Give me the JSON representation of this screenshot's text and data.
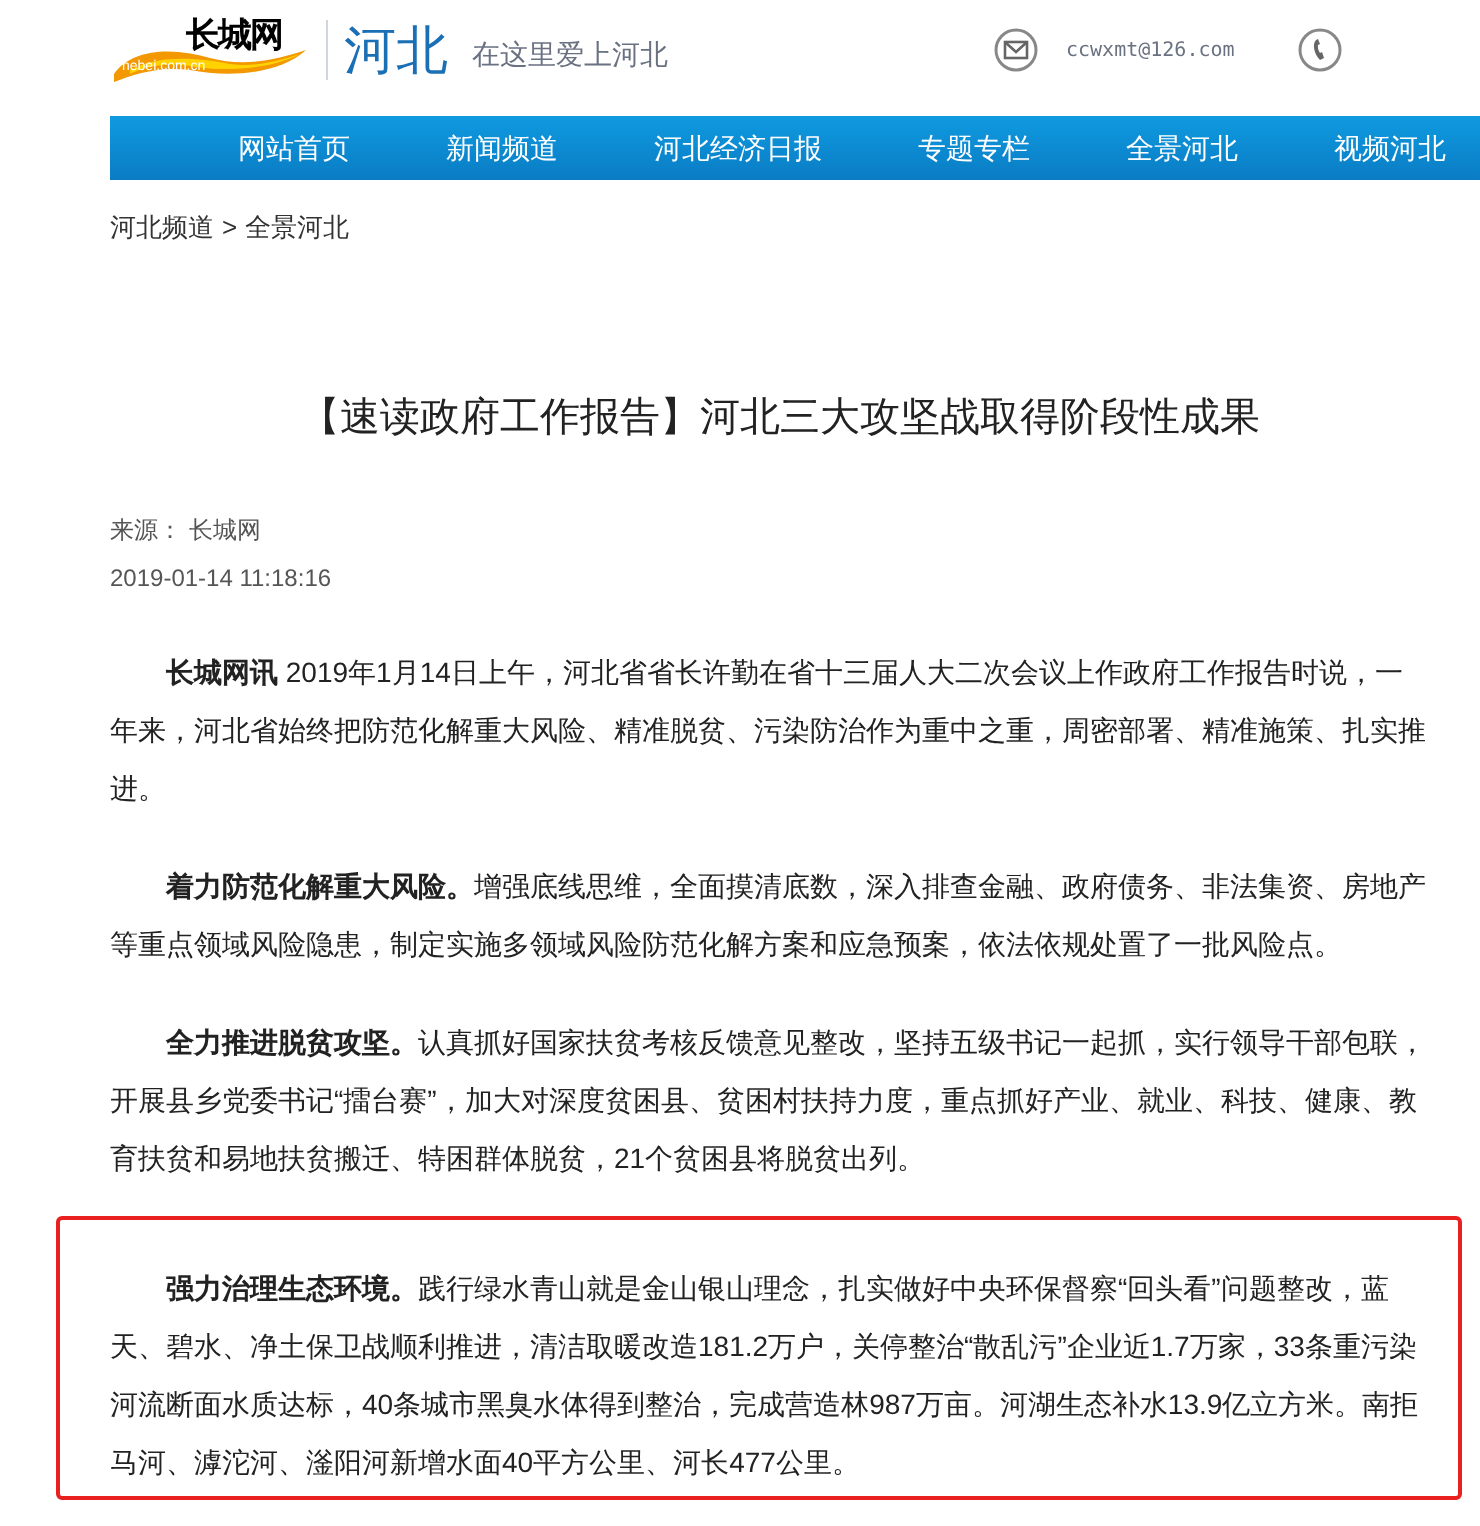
{
  "header": {
    "logo_text": "长城网",
    "logo_domain": "hebei.com.cn",
    "region": "河北",
    "slogan": "在这里爱上河北",
    "email": "ccwxmt@126.com"
  },
  "nav": [
    {
      "label": "网站首页"
    },
    {
      "label": "新闻频道"
    },
    {
      "label": "河北经济日报"
    },
    {
      "label": "专题专栏"
    },
    {
      "label": "全景河北"
    },
    {
      "label": "视频河北"
    }
  ],
  "breadcrumb": {
    "parent": "河北频道",
    "separator": ">",
    "current": "全景河北"
  },
  "article": {
    "title": "【速读政府工作报告】河北三大攻坚战取得阶段性成果",
    "source": "来源： 长城网",
    "date": "2019-01-14 11:18:16",
    "paragraphs": [
      {
        "text": "**长城网讯** 2019年1月14日上午，河北省省长许勤在省十三届人大二次会议上作政府工作报告时说，一年来，河北省始终把防范化解重大风险、精准脱贫、污染防治作为重中之重，周密部署、精准施策、扎实推进。",
        "highlighted": false
      },
      {
        "text": "**着力防范化解重大风险。**增强底线思维，全面摸清底数，深入排查金融、政府债务、非法集资、房地产等重点领域风险隐患，制定实施多领域风险防范化解方案和应急预案，依法依规处置了一批风险点。",
        "highlighted": false
      },
      {
        "text": "**全力推进脱贫攻坚。**认真抓好国家扶贫考核反馈意见整改，坚持五级书记一起抓，实行领导干部包联，开展县乡党委书记“擂台赛”，加大对深度贫困县、贫困村扶持力度，重点抓好产业、就业、科技、健康、教育扶贫和易地扶贫搬迁、特困群体脱贫，21个贫困县将脱贫出列。",
        "highlighted": false
      },
      {
        "text": "**强力治理生态环境。**践行绿水青山就是金山银山理念，扎实做好中央环保督察“回头看”问题整改，蓝天、碧水、净土保卫战顺利推进，清洁取暖改造181.2万户，关停整治“散乱污”企业近1.7万家，33条重污染河流断面水质达标，40条城市黑臭水体得到整治，完成营造林987万亩。河湖生态补水13.9亿立方米。南拒马河、滹沱河、滏阳河新增水面40平方公里、河长477公里。",
        "highlighted": true
      }
    ]
  }
}
